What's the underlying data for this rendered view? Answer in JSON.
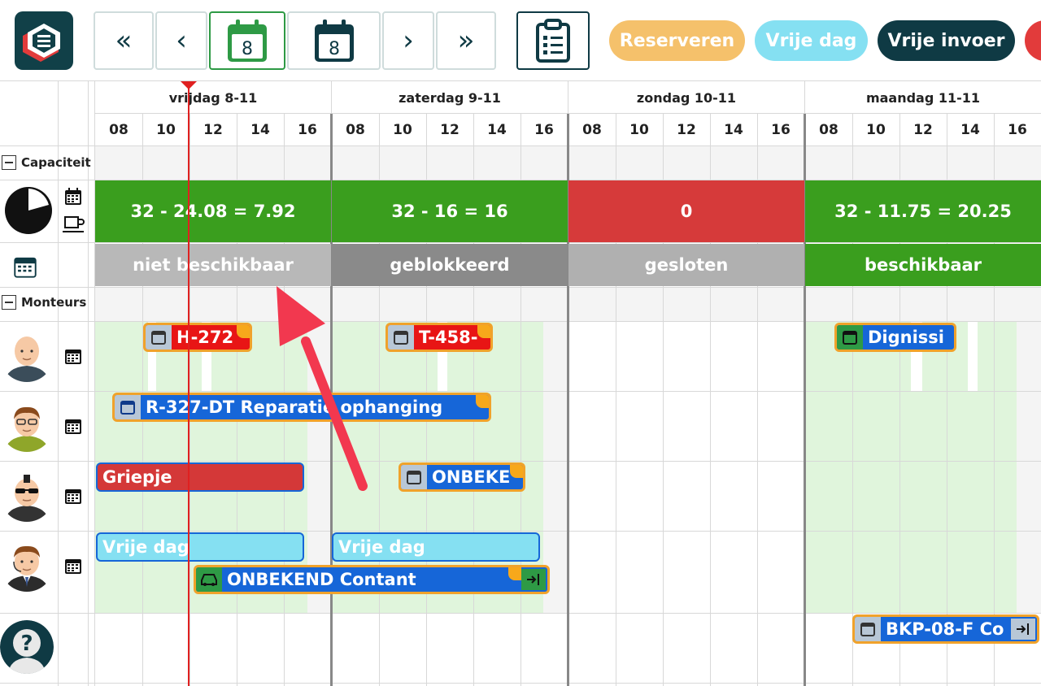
{
  "toolbar": {
    "first_label": "«",
    "prev_label": "‹",
    "today_day": "8",
    "selected_day": "8",
    "next_label": "›",
    "last_label": "»",
    "buttons": [
      {
        "label": "Reserveren",
        "color": "#f5c16b"
      },
      {
        "label": "Vrije dag",
        "color": "#85e0f2"
      },
      {
        "label": "Vrije invoer",
        "color": "#0f3a44"
      }
    ]
  },
  "days": [
    {
      "label": "vrijdag 8-11",
      "hours": [
        "08",
        "10",
        "12",
        "14",
        "16"
      ]
    },
    {
      "label": "zaterdag 9-11",
      "hours": [
        "08",
        "10",
        "12",
        "14",
        "16"
      ]
    },
    {
      "label": "zondag 10-11",
      "hours": [
        "08",
        "10",
        "12",
        "14",
        "16"
      ]
    },
    {
      "label": "maandag 11-11",
      "hours": [
        "08",
        "10",
        "12",
        "14",
        "16"
      ]
    }
  ],
  "sections": {
    "capacity": "Capaciteit",
    "mechanics": "Monteurs"
  },
  "capacity": [
    {
      "text": "32 - 24.08 = 7.92",
      "color": "#3a9e1e"
    },
    {
      "text": "32 - 16 = 16",
      "color": "#3a9e1e"
    },
    {
      "text": "0",
      "color": "#d63a3a"
    },
    {
      "text": "32 - 11.75 = 20.25",
      "color": "#3a9e1e"
    }
  ],
  "status": [
    {
      "text": "niet beschikbaar",
      "color": "#b8b8b8"
    },
    {
      "text": "geblokkeerd",
      "color": "#8a8a8a"
    },
    {
      "text": "gesloten",
      "color": "#b0b0b0"
    },
    {
      "text": "beschikbaar",
      "color": "#3a9e1e"
    }
  ],
  "events": {
    "e1": "H-272",
    "e2": "T-458-",
    "e3": "Dignissi",
    "e4": "R-327-DT Reparatie ophanging",
    "e5": "Griepje",
    "e6": "ONBEKE",
    "e7": "Vrije dag",
    "e8": "Vrije dag",
    "e9": "ONBEKEND Contant",
    "e10": "BKP-08-F Co"
  }
}
